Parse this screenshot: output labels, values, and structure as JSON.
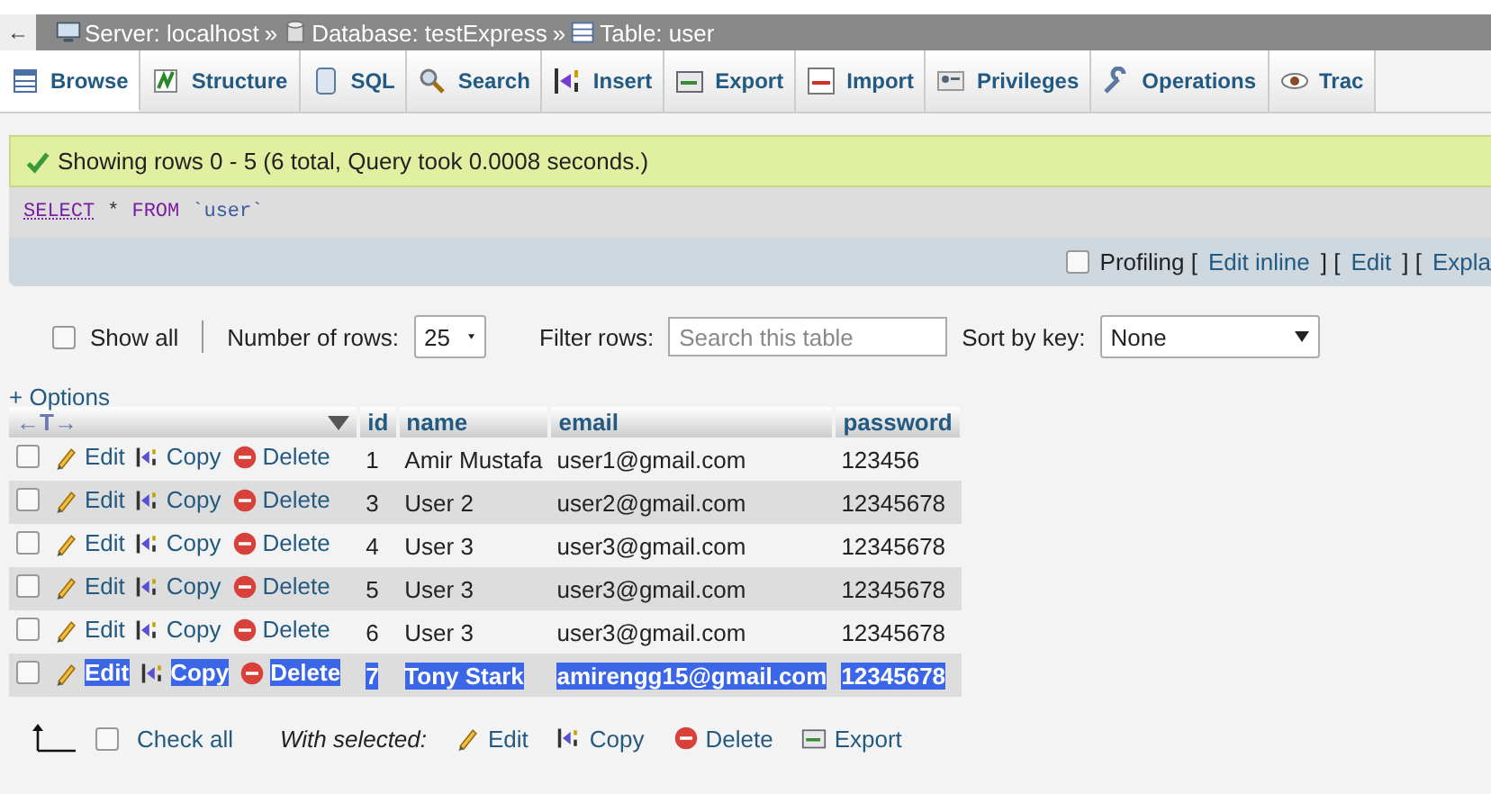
{
  "breadcrumb": [
    {
      "kind": "server",
      "text": "Server: localhost"
    },
    {
      "kind": "database",
      "text": "Database: testExpress"
    },
    {
      "kind": "table",
      "text": "Table: user"
    }
  ],
  "breadcrumb_separator": "»",
  "back_button": "←",
  "tabs": [
    {
      "label": "Browse",
      "selected": true
    },
    {
      "label": "Structure",
      "selected": false
    },
    {
      "label": "SQL",
      "selected": false
    },
    {
      "label": "Search",
      "selected": false
    },
    {
      "label": "Insert",
      "selected": false
    },
    {
      "label": "Export",
      "selected": false
    },
    {
      "label": "Import",
      "selected": false
    },
    {
      "label": "Privileges",
      "selected": false
    },
    {
      "label": "Operations",
      "selected": false
    },
    {
      "label": "Trac",
      "selected": false
    }
  ],
  "message": "Showing rows 0 - 5 (6 total, Query took 0.0008 seconds.)",
  "query": [
    {
      "kind": "keyword",
      "text": "SELECT"
    },
    {
      "kind": "plain",
      "text": "*"
    },
    {
      "kind": "keyword2",
      "text": "FROM"
    },
    {
      "kind": "ident",
      "text": "`user`"
    }
  ],
  "profiling": {
    "checked": false,
    "segments": [
      {
        "kind": "text",
        "text": "Profiling ["
      },
      {
        "kind": "link",
        "text": "Edit inline"
      },
      {
        "kind": "text",
        "text": "] ["
      },
      {
        "kind": "link",
        "text": "Edit"
      },
      {
        "kind": "text",
        "text": "] ["
      },
      {
        "kind": "link",
        "text": "Expla"
      }
    ]
  },
  "controls": {
    "show_all": {
      "label": "Show all",
      "checked": false
    },
    "rows_label": "Number of rows:",
    "rows_value": "25",
    "filter_label": "Filter rows:",
    "filter_placeholder": "Search this table",
    "sort_label": "Sort by key:",
    "sort_value": "None"
  },
  "options_link": "+ Options",
  "resize_glyph": "←T→",
  "table": {
    "columns": [
      "id",
      "name",
      "email",
      "password"
    ],
    "rows": [
      {
        "checked": false,
        "highlighted": false,
        "actions": [
          "Edit",
          "Copy",
          "Delete"
        ],
        "cells": [
          "1",
          "Amir Mustafa",
          "user1@gmail.com",
          "123456"
        ]
      },
      {
        "checked": false,
        "highlighted": false,
        "actions": [
          "Edit",
          "Copy",
          "Delete"
        ],
        "cells": [
          "3",
          "User 2",
          "user2@gmail.com",
          "12345678"
        ]
      },
      {
        "checked": false,
        "highlighted": false,
        "actions": [
          "Edit",
          "Copy",
          "Delete"
        ],
        "cells": [
          "4",
          "User 3",
          "user3@gmail.com",
          "12345678"
        ]
      },
      {
        "checked": false,
        "highlighted": false,
        "actions": [
          "Edit",
          "Copy",
          "Delete"
        ],
        "cells": [
          "5",
          "User 3",
          "user3@gmail.com",
          "12345678"
        ]
      },
      {
        "checked": false,
        "highlighted": false,
        "actions": [
          "Edit",
          "Copy",
          "Delete"
        ],
        "cells": [
          "6",
          "User 3",
          "user3@gmail.com",
          "12345678"
        ]
      },
      {
        "checked": false,
        "highlighted": true,
        "actions": [
          "Edit",
          "Copy",
          "Delete"
        ],
        "cells": [
          "7",
          "Tony Stark",
          "amirengg15@gmail.com",
          "12345678"
        ]
      }
    ]
  },
  "footer": {
    "check_all": {
      "label": "Check all",
      "checked": false
    },
    "with_selected": "With selected:",
    "actions": [
      {
        "kind": "edit",
        "label": "Edit"
      },
      {
        "kind": "copy",
        "label": "Copy"
      },
      {
        "kind": "delete",
        "label": "Delete"
      },
      {
        "kind": "export",
        "label": "Export"
      }
    ]
  }
}
